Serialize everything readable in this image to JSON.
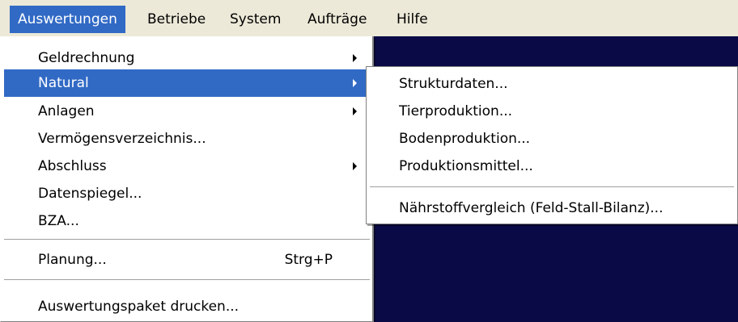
{
  "menubar": {
    "items": [
      "Auswertungen",
      "Betriebe",
      "System",
      "Aufträge",
      "Hilfe"
    ]
  },
  "auswertungen_menu": {
    "items": [
      {
        "label": "Geldrechnung",
        "submenu": true
      },
      {
        "label": "Natural",
        "submenu": true,
        "highlighted": true
      },
      {
        "label": "Anlagen",
        "submenu": true
      },
      {
        "label": "Vermögensverzeichnis...",
        "submenu": false
      },
      {
        "label": "Abschluss",
        "submenu": true
      },
      {
        "label": "Datenspiegel...",
        "submenu": false
      },
      {
        "label": "BZA...",
        "submenu": false
      },
      {
        "label": "Planung...",
        "shortcut": "Strg+P"
      },
      {
        "label": "Auswertungspaket drucken..."
      }
    ]
  },
  "natural_submenu": {
    "items": [
      "Strukturdaten...",
      "Tierproduktion...",
      "Bodenproduktion...",
      "Produktionsmittel...",
      "Nährstoffvergleich (Feld-Stall-Bilanz)..."
    ]
  },
  "colors": {
    "highlight": "#316ac5",
    "menubar_bg": "#ece9d8",
    "workspace_bg": "#0a0a46"
  }
}
